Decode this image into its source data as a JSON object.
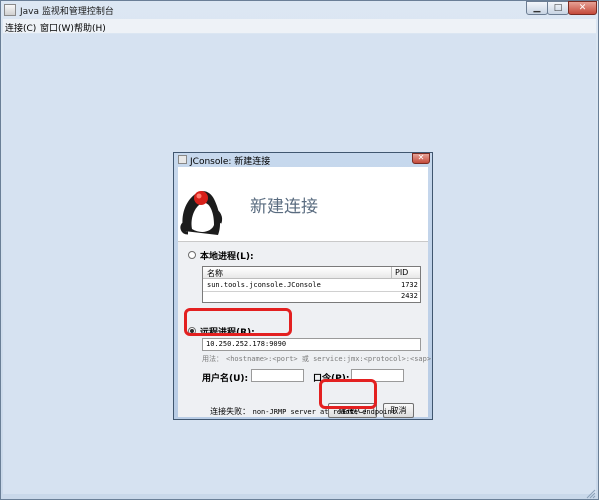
{
  "window": {
    "title": "Java 监视和管理控制台",
    "controls": {
      "minimize": "▁",
      "maximize": "□",
      "close": "✕"
    }
  },
  "menubar": {
    "items": [
      "连接(C)",
      "窗口(W)",
      "帮助(H)"
    ]
  },
  "dialog": {
    "title": "JConsole: 新建连接",
    "close_glyph": "✕",
    "heading": "新建连接",
    "local": {
      "label": "本地进程(L):",
      "selected": false,
      "columns": [
        "名称",
        "PID"
      ],
      "rows": [
        {
          "name": "sun.tools.jconsole.JConsole",
          "pid": "1732"
        },
        {
          "name": "",
          "pid": "2432"
        }
      ]
    },
    "remote": {
      "label": "远程进程(R):",
      "selected": true,
      "value": "10.250.252.178:9090",
      "usage_prefix": "用法：",
      "usage_text": "<hostname>:<port> 或 service:jmx:<protocol>:<sap>"
    },
    "username_label": "用户名(U):",
    "password_label": "口令(P):",
    "connect_label": "连接(C)",
    "cancel_label": "取消",
    "status_prefix": "连接失败：",
    "status_text": "non-JRMP server at remote endpoint"
  },
  "colors": {
    "highlight": "#e32020",
    "desktop": "#d6e2f1",
    "heading": "#5a6c80"
  }
}
